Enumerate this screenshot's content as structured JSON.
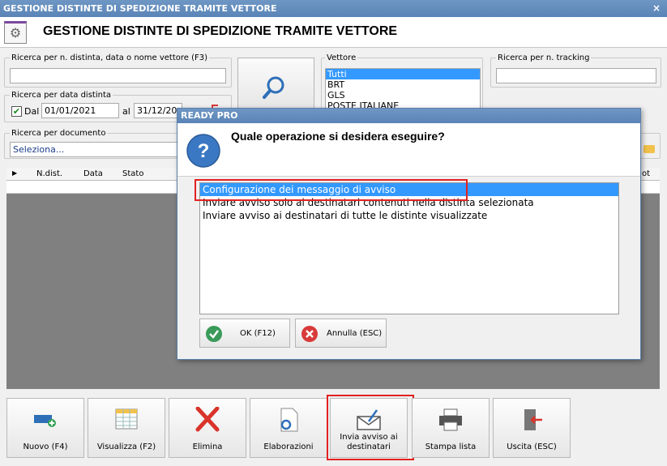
{
  "window": {
    "title": "GESTIONE DISTINTE DI SPEDIZIONE TRAMITE VETTORE",
    "close": "×"
  },
  "header": {
    "title": "GESTIONE DISTINTE DI SPEDIZIONE TRAMITE VETTORE",
    "icon": "gears-icon"
  },
  "search": {
    "number_label": "Ricerca per n. distinta, data o nome vettore (F3)",
    "number_value": "",
    "date_label": "Ricerca per data distinta",
    "from_checkbox_label": "Dal",
    "from_checked": true,
    "from_date": "01/01/2021",
    "to_label": "al",
    "to_date": "31/12/20",
    "document_label": "Ricerca per documento",
    "document_value": "Seleziona...",
    "carrier_label": "Vettore",
    "carriers": [
      "Tutti",
      "BRT",
      "GLS",
      "POSTE ITALIANE"
    ],
    "selected_carrier": "Tutti",
    "tracking_label": "Ricerca per n. tracking",
    "tracking_value": ""
  },
  "grid": {
    "columns": [
      "N.dist.",
      "Data",
      "Stato"
    ],
    "last_col_fragment": "ot"
  },
  "dialog": {
    "title": "READY PRO",
    "question": "Quale operazione si desidera eseguire?",
    "options": [
      "Configurazione dei messaggio di avviso",
      "Inviare avviso solo ai destinatari contenuti nella distinta selezionata",
      "Inviare avviso ai destinatari di tutte le distinte visualizzate"
    ],
    "selected_index": 0,
    "ok_label": "OK (F12)",
    "cancel_label": "Annulla (ESC)"
  },
  "toolbar": {
    "new": "Nuovo (F4)",
    "view": "Visualizza (F2)",
    "delete": "Elimina",
    "process": "Elaborazioni",
    "send_line1": "Invia avviso ai",
    "send_line2": "destinatari",
    "print": "Stampa lista",
    "exit": "Uscita (ESC)"
  },
  "colors": {
    "title_bar": "#5a84b6",
    "selection": "#3399ff",
    "highlight": "#e32121",
    "ok_green": "#3a9a5a",
    "cancel_red": "#d83a3a"
  }
}
